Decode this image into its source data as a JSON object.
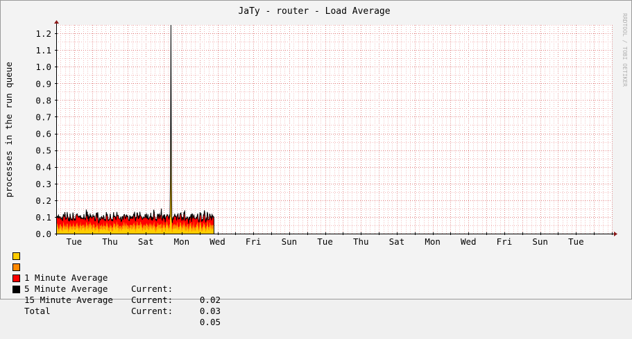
{
  "chart_data": {
    "type": "area",
    "title": "JaTy - router - Load Average",
    "ylabel": "processes in the run queue",
    "watermark": "RRDTOOL / TOBI OETIKER",
    "ylim": [
      0,
      1.25
    ],
    "y_ticks": [
      0.0,
      0.1,
      0.2,
      0.3,
      0.4,
      0.5,
      0.6,
      0.7,
      0.8,
      0.9,
      1.0,
      1.1,
      1.2
    ],
    "x_tick_labels": [
      "Tue",
      "Thu",
      "Sat",
      "Mon",
      "Wed",
      "Fri",
      "Sun",
      "Tue",
      "Thu",
      "Sat",
      "Mon",
      "Wed",
      "Fri",
      "Sun",
      "Tue"
    ],
    "xlim": [
      0,
      31
    ],
    "x_days": [
      1,
      3,
      5,
      7,
      9,
      11,
      13,
      15,
      17,
      19,
      21,
      23,
      25,
      27,
      29
    ],
    "grid": true,
    "legend_position": "bottom-left",
    "data_end": 8.8,
    "spike": {
      "x": 6.4,
      "value": 1.25
    },
    "series": [
      {
        "name": "1 Minute Average",
        "color": "#ffcc00",
        "current": "0.02"
      },
      {
        "name": "5 Minute Average",
        "color": "#ff8800",
        "current": "0.03"
      },
      {
        "name": "15 Minute Average",
        "color": "#ff0000",
        "current": "0.05"
      },
      {
        "name": "Total",
        "color": "#000000"
      }
    ],
    "current_label": "Current:"
  },
  "colors": {
    "background": "#f3f3f3",
    "plot_background": "#ffffff",
    "grid_minor": "#f2b8b8",
    "grid_major": "#e08080",
    "axis": "#000000",
    "arrow": "#8b1a1a"
  }
}
